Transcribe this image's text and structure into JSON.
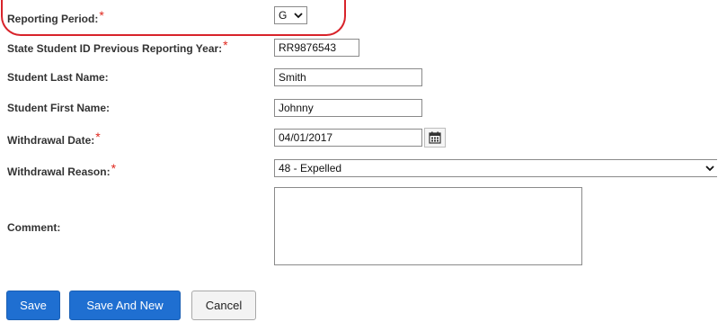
{
  "form": {
    "reporting_period": {
      "label": "Reporting Period:",
      "value": "G",
      "required": "*"
    },
    "state_student_id": {
      "label": "State Student ID Previous Reporting Year:",
      "value": "RR9876543",
      "required": "*"
    },
    "last_name": {
      "label": "Student Last Name:",
      "value": "Smith"
    },
    "first_name": {
      "label": "Student First Name:",
      "value": "Johnny"
    },
    "withdrawal_date": {
      "label": "Withdrawal Date:",
      "value": "04/01/2017",
      "required": "*"
    },
    "withdrawal_reason": {
      "label": "Withdrawal Reason:",
      "value": "48 - Expelled",
      "required": "*"
    },
    "comment": {
      "label": "Comment:",
      "value": ""
    }
  },
  "buttons": {
    "save": "Save",
    "save_and_new": "Save And New",
    "cancel": "Cancel"
  },
  "colors": {
    "required": "#e0281e",
    "highlight": "#d8232a",
    "primary_button": "#1f6fd1"
  },
  "icons": {
    "calendar": "calendar-icon",
    "dropdown": "chevron-down-icon"
  }
}
